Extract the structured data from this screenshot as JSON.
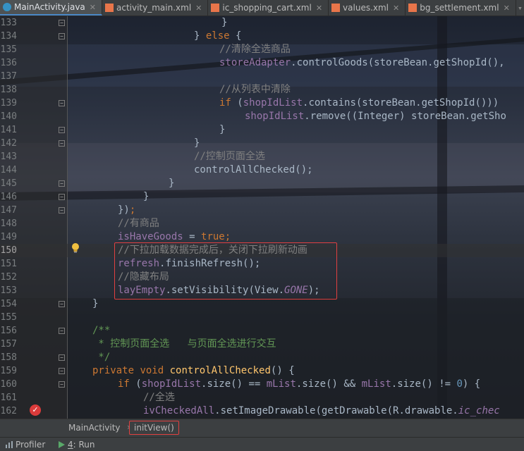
{
  "tabs": [
    {
      "label": "MainActivity.java",
      "icon": "java-class-icon",
      "active": true
    },
    {
      "label": "activity_main.xml",
      "icon": "xml-file-icon",
      "active": false
    },
    {
      "label": "ic_shopping_cart.xml",
      "icon": "xml-file-icon",
      "active": false
    },
    {
      "label": "values.xml",
      "icon": "xml-file-icon",
      "active": false
    },
    {
      "label": "bg_settlement.xml",
      "icon": "xml-file-icon",
      "active": false
    }
  ],
  "lines": [
    {
      "n": "133"
    },
    {
      "n": "134"
    },
    {
      "n": "135"
    },
    {
      "n": "136"
    },
    {
      "n": "137"
    },
    {
      "n": "138"
    },
    {
      "n": "139"
    },
    {
      "n": "140"
    },
    {
      "n": "141"
    },
    {
      "n": "142"
    },
    {
      "n": "143"
    },
    {
      "n": "144"
    },
    {
      "n": "145"
    },
    {
      "n": "146"
    },
    {
      "n": "147"
    },
    {
      "n": "148"
    },
    {
      "n": "149"
    },
    {
      "n": "150"
    },
    {
      "n": "151"
    },
    {
      "n": "152"
    },
    {
      "n": "153"
    },
    {
      "n": "154"
    },
    {
      "n": "155"
    },
    {
      "n": "156"
    },
    {
      "n": "157"
    },
    {
      "n": "158"
    },
    {
      "n": "159"
    },
    {
      "n": "160"
    },
    {
      "n": "161"
    },
    {
      "n": "162"
    }
  ],
  "code": {
    "l133": "}",
    "l134_a": "} ",
    "l134_kw": "else",
    "l134_b": " {",
    "l135": "//清除全选商品",
    "l136_f": "storeAdapter",
    "l136_b": ".controlGoods(storeBean.getShopId(),",
    "l138": "//从列表中清除",
    "l139_kw": "if",
    "l139_a": " (",
    "l139_f": "shopIdList",
    "l139_b": ".contains(storeBean.getShopId()))",
    "l140_f": "shopIdList",
    "l140_b": ".remove((Integer) storeBean.getSho",
    "l141": "}",
    "l142": "}",
    "l143": "//控制页面全选",
    "l144": "controlAllChecked();",
    "l145": "}",
    "l146": "}",
    "l147_a": "})",
    "l147_b": ";",
    "l148": "//有商品",
    "l149_f": "isHaveGoods",
    "l149_a": " = ",
    "l149_kw": "true",
    "l149_b": ";",
    "l150": "//下拉加载数据完成后，关闭下拉刷新动画",
    "l151_f": "refresh",
    "l151_b": ".finishRefresh();",
    "l152": "//隐藏布局",
    "l153_f": "layEmpty",
    "l153_a": ".setVisibility(View.",
    "l153_c": "GONE",
    "l153_b": ");",
    "l154": "}",
    "l156": "/**",
    "l157": " * 控制页面全选   与页面全选进行交互",
    "l158": " */",
    "l159_kw1": "private",
    "l159_kw2": "void",
    "l159_fn": "controlAllChecked",
    "l159_b": "() {",
    "l160_kw": "if",
    "l160_a": " (",
    "l160_f1": "shopIdList",
    "l160_b": ".size() == ",
    "l160_f2": "mList",
    "l160_c": ".size() && ",
    "l160_f3": "mList",
    "l160_d": ".size() != ",
    "l160_num": "0",
    "l160_e": ") {",
    "l161": "//全选",
    "l162_f": "ivCheckedAll",
    "l162_a": ".setImageDrawable(getDrawable(R.drawable.",
    "l162_c": "ic_chec"
  },
  "breadcrumbs": {
    "class_name": "MainActivity",
    "method_name": "initView()"
  },
  "statusbar": {
    "profiler": "Profiler",
    "run_num": "4",
    "run_label": ": Run"
  },
  "colors": {
    "keyword": "#cc7832",
    "field": "#9876aa",
    "comment": "#808080",
    "doc_comment": "#629755",
    "method_decl": "#ffc66d",
    "number": "#6897bb",
    "highlight_box": "#e04040"
  }
}
